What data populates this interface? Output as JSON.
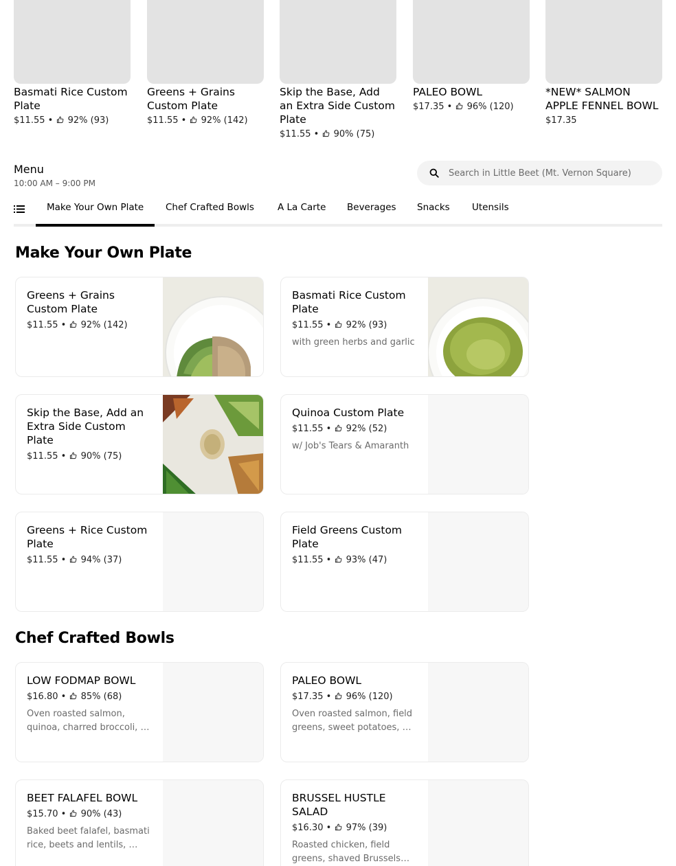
{
  "featured": [
    {
      "name": "Basmati Rice Custom Plate",
      "price": "$11.55",
      "rating": "92% (93)"
    },
    {
      "name": "Greens + Grains Custom Plate",
      "price": "$11.55",
      "rating": "92% (142)"
    },
    {
      "name": "Skip the Base, Add an Extra Side Custom Plate",
      "price": "$11.55",
      "rating": "90% (75)"
    },
    {
      "name": "PALEO BOWL",
      "price": "$17.35",
      "rating": "96% (120)"
    },
    {
      "name": "*NEW* SALMON APPLE FENNEL BOWL",
      "price": "$17.35",
      "rating": ""
    }
  ],
  "menu": {
    "title": "Menu",
    "hours": "10:00 AM – 9:00 PM"
  },
  "search": {
    "placeholder": "Search in Little Beet (Mt. Vernon Square)"
  },
  "tabs": [
    "Make Your Own Plate",
    "Chef Crafted Bowls",
    "A La Carte",
    "Beverages",
    "Snacks",
    "Utensils"
  ],
  "sections": [
    {
      "title": "Make Your Own Plate",
      "items": [
        {
          "name": "Greens + Grains Custom Plate",
          "price": "$11.55",
          "rating": "92% (142)",
          "desc": ""
        },
        {
          "name": "Basmati Rice Custom Plate",
          "price": "$11.55",
          "rating": "92% (93)",
          "desc": "with green herbs and garlic"
        },
        {
          "name": "Skip the Base, Add an Extra Side Custom Plate",
          "price": "$11.55",
          "rating": "90% (75)",
          "desc": ""
        },
        {
          "name": "Quinoa Custom Plate",
          "price": "$11.55",
          "rating": "92% (52)",
          "desc": "w/ Job's Tears & Amaranth"
        },
        {
          "name": "Greens + Rice Custom Plate",
          "price": "$11.55",
          "rating": "94% (37)",
          "desc": ""
        },
        {
          "name": "Field Greens Custom Plate",
          "price": "$11.55",
          "rating": "93% (47)",
          "desc": ""
        }
      ]
    },
    {
      "title": "Chef Crafted Bowls",
      "items": [
        {
          "name": "LOW FODMAP BOWL",
          "price": "$16.80",
          "rating": "85% (68)",
          "desc": "Oven roasted salmon, quinoa, charred broccoli, …"
        },
        {
          "name": "PALEO BOWL",
          "price": "$17.35",
          "rating": "96% (120)",
          "desc": "Oven roasted salmon, field greens, sweet potatoes, …"
        },
        {
          "name": "BEET FALAFEL BOWL",
          "price": "$15.70",
          "rating": "90% (43)",
          "desc": "Baked beet falafel, basmati rice, beets and lentils, …"
        },
        {
          "name": "BRUSSEL HUSTLE SALAD",
          "price": "$16.30",
          "rating": "97% (39)",
          "desc": "Roasted chicken, field greens, shaved Brussels…"
        }
      ]
    }
  ],
  "separator": "•",
  "icons": {
    "rating": "thumbs-up-icon",
    "search": "search-icon",
    "category_list": "list-icon"
  }
}
